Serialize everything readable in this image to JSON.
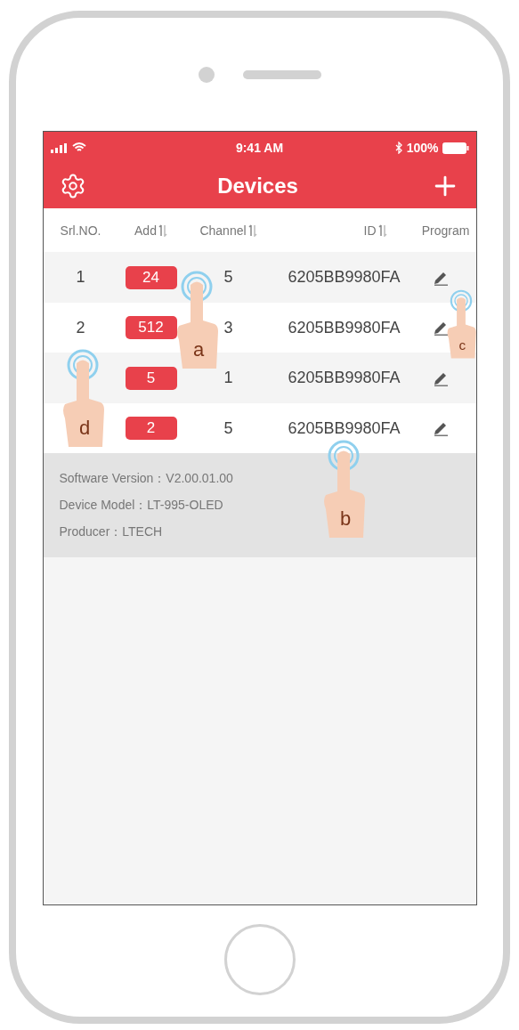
{
  "status_bar": {
    "time": "9:41 AM",
    "battery": "100%"
  },
  "header": {
    "title": "Devices"
  },
  "table": {
    "columns": [
      {
        "label": "Srl.NO.",
        "sortable": false
      },
      {
        "label": "Add",
        "sortable": true
      },
      {
        "label": "Channel",
        "sortable": true
      },
      {
        "label": "ID",
        "sortable": true
      },
      {
        "label": "Program",
        "sortable": false
      }
    ],
    "rows": [
      {
        "srl": "1",
        "add": "24",
        "channel": "5",
        "id": "6205BB9980FA"
      },
      {
        "srl": "2",
        "add": "512",
        "channel": "3",
        "id": "6205BB9980FA"
      },
      {
        "add": "5",
        "channel": "1",
        "id": "6205BB9980FA"
      },
      {
        "add": "2",
        "channel": "5",
        "id": "6205BB9980FA"
      }
    ]
  },
  "info": [
    "Software Version：V2.00.01.00",
    "Device Model：LT-995-OLED",
    "Producer：LTECH"
  ],
  "gestures": [
    {
      "label": "a"
    },
    {
      "label": "b"
    },
    {
      "label": "c"
    },
    {
      "label": "d"
    }
  ]
}
